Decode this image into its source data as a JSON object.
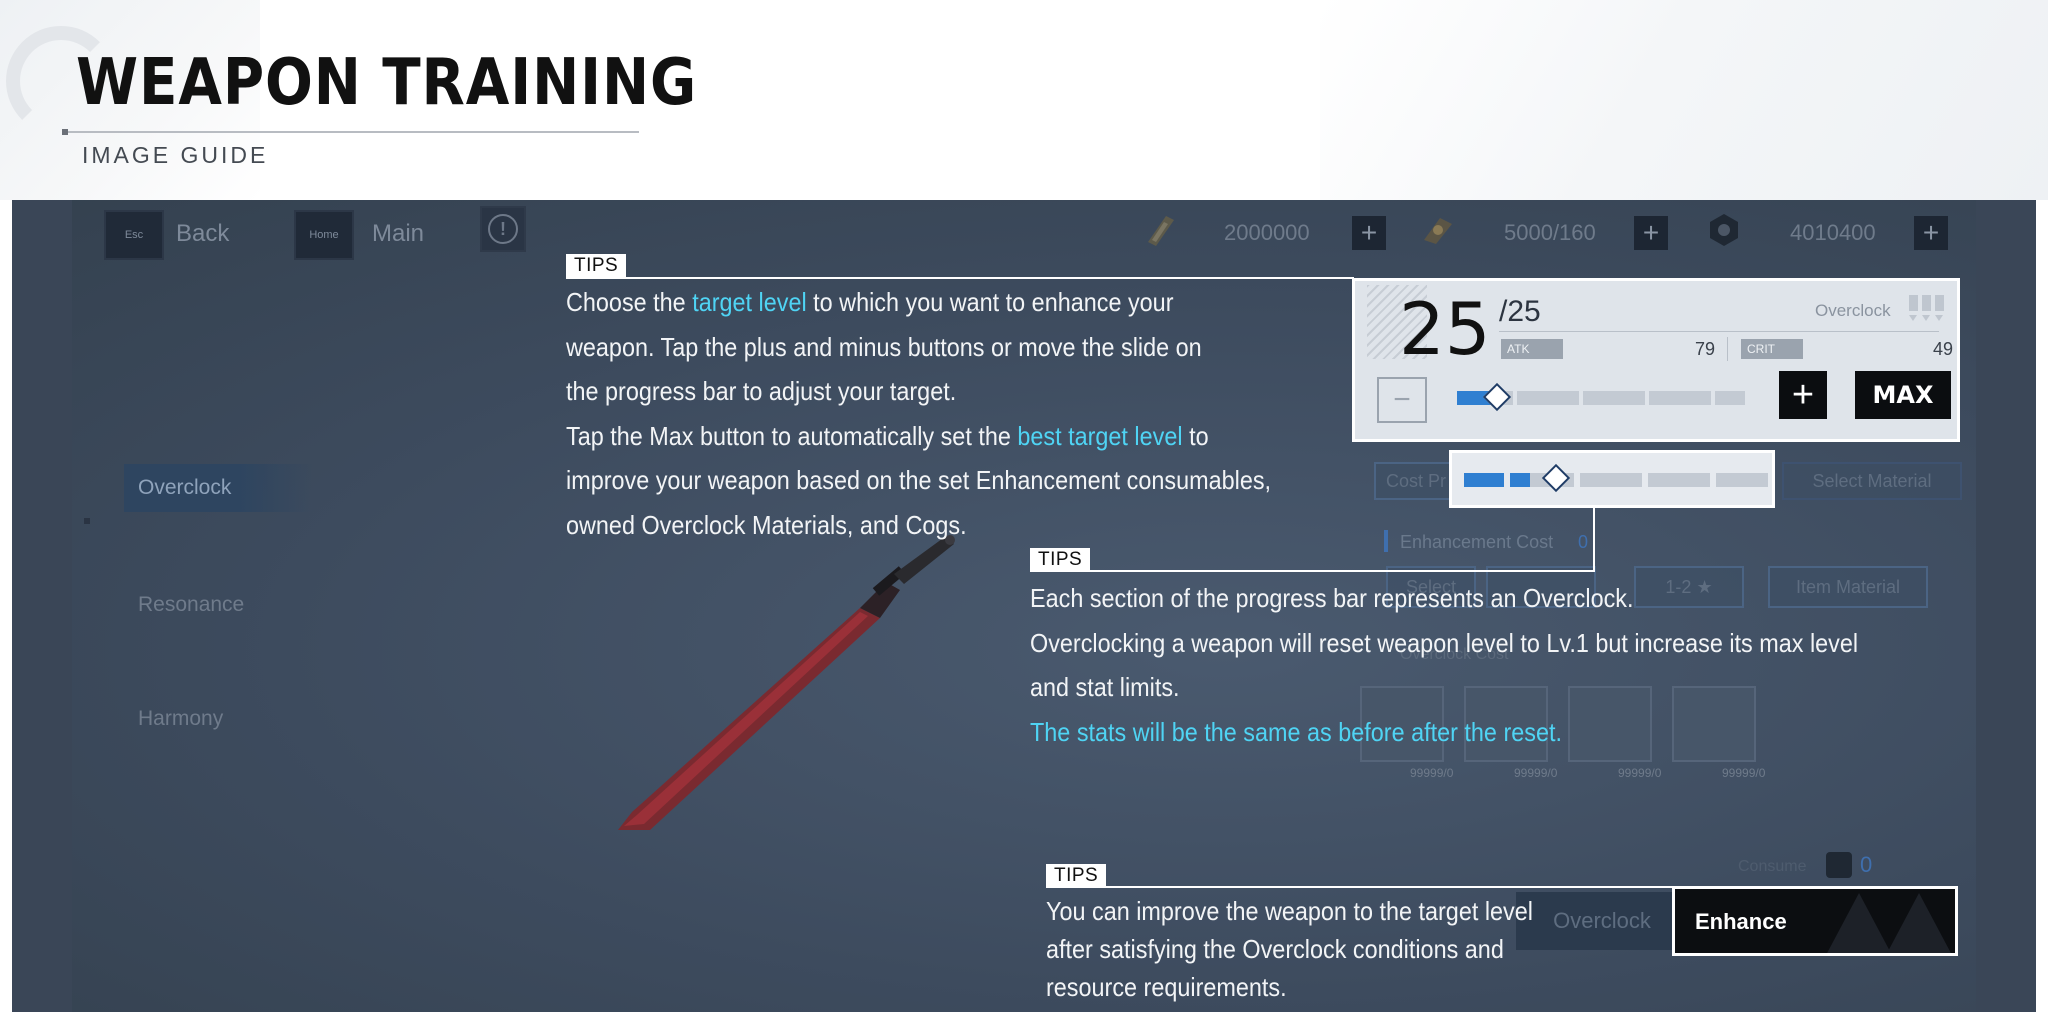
{
  "header": {
    "title": "WEAPON TRAINING",
    "subtitle": "IMAGE GUIDE"
  },
  "game": {
    "top_bar": {
      "back_key": "Esc",
      "back_label": "Back",
      "main_key": "Home",
      "main_label": "Main",
      "resources": [
        {
          "icon": "weapon-material-icon",
          "value": "2000000"
        },
        {
          "icon": "overclock-material-icon",
          "value": "5000/160"
        },
        {
          "icon": "cog-icon",
          "value": "4010400"
        }
      ]
    },
    "side_menu": [
      {
        "label": "Overclock",
        "active": true
      },
      {
        "label": "Resonance",
        "active": false
      },
      {
        "label": "Harmony",
        "active": false
      }
    ],
    "level_panel": {
      "current_level": "25",
      "max_level": "/25",
      "overclock_label": "Overclock",
      "stats": [
        {
          "label": "ATK",
          "value": "79"
        },
        {
          "label": "CRIT",
          "value": "49"
        }
      ],
      "max_button": "MAX"
    },
    "right_panel": {
      "cost_label": "Cost Pr",
      "select_material": "Select Material",
      "enhancement_cost": "Enhancement Cost",
      "enhancement_cost_value": "0",
      "chip_1": "Select",
      "chip_2": "1-2 ★",
      "chip_3": "Item Material",
      "overclock_cost": "Overclock Cost",
      "materials": [
        "99999/0",
        "99999/0",
        "99999/0",
        "99999/0"
      ],
      "consume_label": "Consume",
      "consume_value": "0",
      "behind_button": "Overclock"
    },
    "enhance_button": "Enhance"
  },
  "tips": [
    {
      "tag": "TIPS",
      "lines": [
        [
          "Choose the ",
          {
            "hl": "target level"
          },
          " to which you want to enhance your"
        ],
        [
          "weapon. Tap the plus and minus buttons or move the slide on"
        ],
        [
          "the progress bar to adjust your target."
        ],
        [
          "Tap the Max button to automatically set the ",
          {
            "hl": "best target level"
          },
          " to"
        ],
        [
          "improve your weapon based on the set Enhancement consumables,"
        ],
        [
          "owned Overclock Materials, and Cogs."
        ]
      ]
    },
    {
      "tag": "TIPS",
      "lines": [
        [
          "Each section of the progress bar represents an Overclock."
        ],
        [
          "Overclocking a weapon will reset weapon level to Lv.1 but increase its max level"
        ],
        [
          "and stat limits."
        ],
        [
          {
            "hl": "The stats will be the same as before after the reset."
          }
        ]
      ]
    },
    {
      "tag": "TIPS",
      "lines": [
        [
          "You can improve the weapon to the target level"
        ],
        [
          "after satisfying the Overclock conditions and"
        ],
        [
          "resource requirements."
        ]
      ]
    }
  ],
  "colors": {
    "highlight": "#4fd4f4",
    "slider_fill": "#2f7fd1",
    "dim_overlay": "#3d4b5e"
  },
  "slider": {
    "segments": 5,
    "progress": 0.12
  }
}
